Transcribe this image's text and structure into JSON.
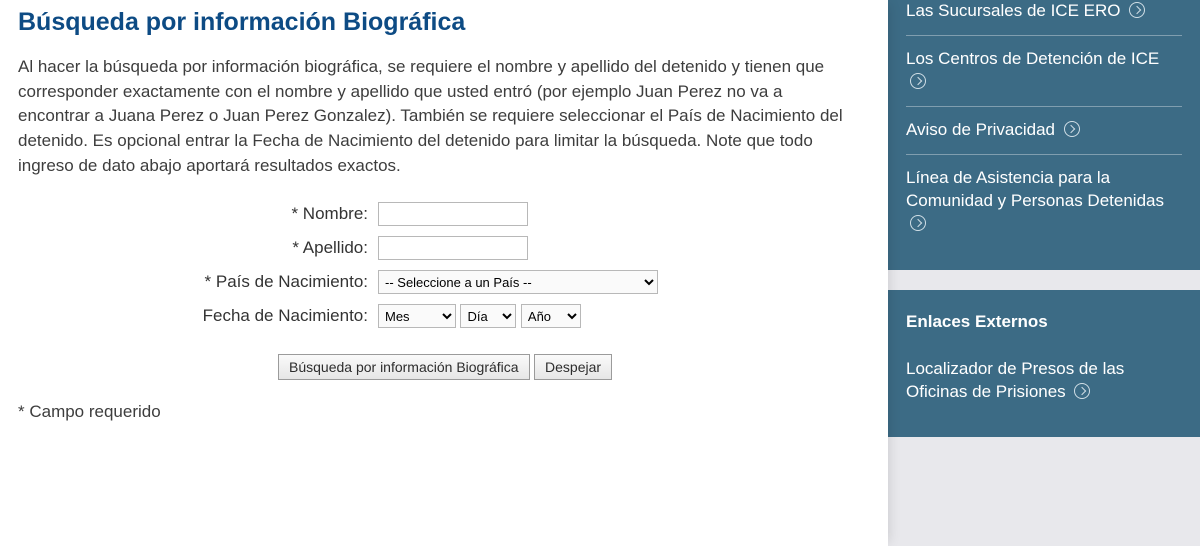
{
  "main": {
    "heading": "Búsqueda por información Biográfica",
    "intro": "Al hacer la búsqueda por información biográfica, se requiere el nombre y apellido del detenido y tienen que corresponder exactamente con el nombre y apellido que usted entró (por ejemplo Juan Perez no va a encontrar a Juana Perez o Juan Perez Gonzalez). También se requiere seleccionar el País de Nacimiento del detenido. Es opcional entrar la Fecha de Nacimiento del detenido para limitar la búsqueda. Note que todo ingreso de dato abajo aportará resultados exactos.",
    "labels": {
      "first_name": "* Nombre:",
      "last_name": "* Apellido:",
      "country": "* País de Nacimiento:",
      "dob": "Fecha de Nacimiento:"
    },
    "options": {
      "country_placeholder": "-- Seleccione a un País --",
      "month_placeholder": "Mes",
      "day_placeholder": "Día",
      "year_placeholder": "Año"
    },
    "buttons": {
      "search": "Búsqueda por información Biográfica",
      "clear": "Despejar"
    },
    "required_note": "* Campo requerido"
  },
  "sidebar": {
    "group1": {
      "links": [
        "Las Sucursales de ICE ERO",
        "Los Centros de Detención de ICE",
        "Aviso de Privacidad",
        "Línea de Asistencia para la Comunidad y Personas Detenidas"
      ]
    },
    "group2": {
      "title": "Enlaces Externos",
      "links": [
        "Localizador de Presos de las Oficinas de Prisiones"
      ]
    }
  }
}
